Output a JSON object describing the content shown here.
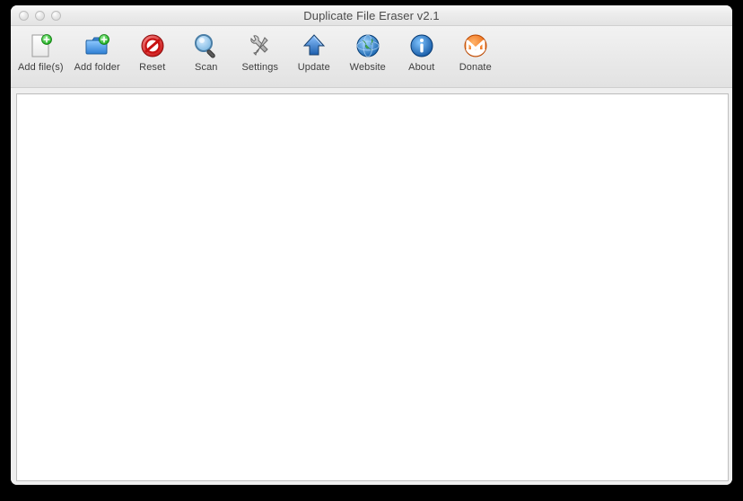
{
  "window": {
    "title": "Duplicate File Eraser v2.1"
  },
  "toolbar": {
    "items": [
      {
        "id": "add-files",
        "label": "Add file(s)",
        "icon": "file-plus-icon"
      },
      {
        "id": "add-folder",
        "label": "Add folder",
        "icon": "folder-plus-icon"
      },
      {
        "id": "reset",
        "label": "Reset",
        "icon": "no-entry-icon"
      },
      {
        "id": "scan",
        "label": "Scan",
        "icon": "magnifier-icon"
      },
      {
        "id": "settings",
        "label": "Settings",
        "icon": "wrench-screwdriver-icon"
      },
      {
        "id": "update",
        "label": "Update",
        "icon": "arrow-up-icon"
      },
      {
        "id": "website",
        "label": "Website",
        "icon": "globe-icon"
      },
      {
        "id": "about",
        "label": "About",
        "icon": "info-icon"
      },
      {
        "id": "donate",
        "label": "Donate",
        "icon": "monero-icon"
      }
    ]
  },
  "content": {
    "rows": []
  }
}
